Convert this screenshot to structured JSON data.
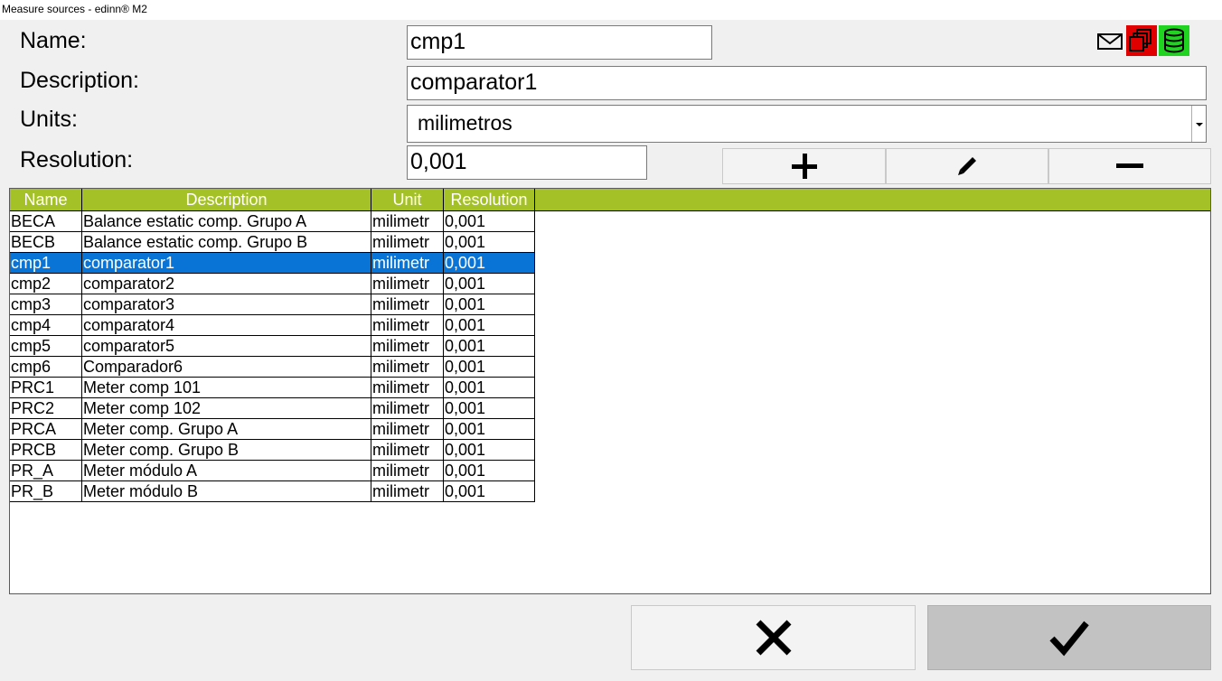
{
  "window": {
    "title": "Measure sources - edinn® M2"
  },
  "form": {
    "name_label": "Name:",
    "name_value": "cmp1",
    "description_label": "Description:",
    "description_value": "comparator1",
    "units_label": "Units:",
    "units_value": "milimetros",
    "resolution_label": "Resolution:",
    "resolution_value": "0,001"
  },
  "icons": {
    "mail": "mail-icon",
    "copy": "copy-windows-icon",
    "database": "database-icon",
    "add": "plus-icon",
    "edit": "pencil-icon",
    "remove": "minus-icon",
    "cancel": "x-icon",
    "ok": "checkmark-icon"
  },
  "colors": {
    "header": "#a4c227",
    "selection": "#0a74d6",
    "copy_bg": "#e00000",
    "db_bg": "#21d321"
  },
  "table": {
    "headers": {
      "name": "Name",
      "description": "Description",
      "unit": "Unit",
      "resolution": "Resolution"
    },
    "rows": [
      {
        "name": "BECA",
        "description": "Balance estatic comp. Grupo A",
        "unit": "milimetr",
        "resolution": "0,001"
      },
      {
        "name": "BECB",
        "description": "Balance estatic comp. Grupo B",
        "unit": "milimetr",
        "resolution": "0,001"
      },
      {
        "name": "cmp1",
        "description": "comparator1",
        "unit": "milimetr",
        "resolution": "0,001",
        "selected": true
      },
      {
        "name": "cmp2",
        "description": "comparator2",
        "unit": "milimetr",
        "resolution": "0,001"
      },
      {
        "name": "cmp3",
        "description": "comparator3",
        "unit": "milimetr",
        "resolution": "0,001"
      },
      {
        "name": "cmp4",
        "description": "comparator4",
        "unit": "milimetr",
        "resolution": "0,001"
      },
      {
        "name": "cmp5",
        "description": "comparator5",
        "unit": "milimetr",
        "resolution": "0,001"
      },
      {
        "name": "cmp6",
        "description": "Comparador6",
        "unit": "milimetr",
        "resolution": "0,001"
      },
      {
        "name": "PRC1",
        "description": "Meter comp 101",
        "unit": "milimetr",
        "resolution": "0,001"
      },
      {
        "name": "PRC2",
        "description": "Meter comp 102",
        "unit": "milimetr",
        "resolution": "0,001"
      },
      {
        "name": "PRCA",
        "description": "Meter comp. Grupo A",
        "unit": "milimetr",
        "resolution": "0,001"
      },
      {
        "name": "PRCB",
        "description": "Meter comp. Grupo B",
        "unit": "milimetr",
        "resolution": "0,001"
      },
      {
        "name": "PR_A",
        "description": "Meter módulo A",
        "unit": "milimetr",
        "resolution": "0,001"
      },
      {
        "name": "PR_B",
        "description": "Meter módulo B",
        "unit": "milimetr",
        "resolution": "0,001"
      }
    ]
  }
}
